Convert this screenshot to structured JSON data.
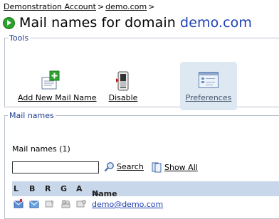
{
  "breadcrumb": {
    "items": [
      "Demonstration Account",
      "demo.com"
    ],
    "separator": ">"
  },
  "page": {
    "title_prefix": "Mail names for domain",
    "title_domain": "demo.com"
  },
  "tools": {
    "legend": "Tools",
    "items": [
      {
        "label": "Add New Mail Name",
        "icon": "add-mail-name-icon"
      },
      {
        "label": "Disable",
        "icon": "disable-switch-icon"
      },
      {
        "label": "Preferences",
        "icon": "preferences-icon",
        "highlighted": true
      }
    ]
  },
  "mail_names": {
    "legend": "Mail names",
    "count_label": "Mail names (1)",
    "search": {
      "value": "",
      "button_label": "Search",
      "show_all_label": "Show All"
    },
    "columns": [
      "L",
      "B",
      "R",
      "G",
      "A",
      "Name"
    ],
    "sort_indicator": "▲",
    "rows": [
      {
        "name": "demo@demo.com"
      }
    ]
  },
  "colors": {
    "accent": "#1f3fb4",
    "header_bg": "#c9d7ea",
    "legend": "#1d3e8f",
    "highlight": "#dde8f3"
  }
}
